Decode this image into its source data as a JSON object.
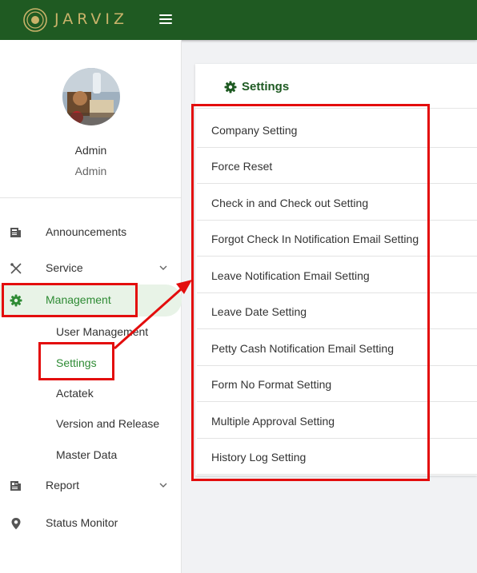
{
  "app": {
    "brand": "JARVIZ"
  },
  "user": {
    "name": "Admin",
    "role": "Admin"
  },
  "sidebar": {
    "items": [
      {
        "label": "Announcements"
      },
      {
        "label": "Service"
      },
      {
        "label": "Management"
      },
      {
        "label": "Report"
      },
      {
        "label": "Status Monitor"
      }
    ],
    "management_sub": [
      {
        "label": "User Management"
      },
      {
        "label": "Settings"
      },
      {
        "label": "Actatek"
      },
      {
        "label": "Version and Release"
      },
      {
        "label": "Master Data"
      }
    ]
  },
  "panel": {
    "title": "Settings",
    "items": [
      {
        "label": "Company Setting"
      },
      {
        "label": "Force Reset"
      },
      {
        "label": "Check in and Check out Setting"
      },
      {
        "label": "Forgot Check In Notification Email Setting"
      },
      {
        "label": "Leave Notification Email Setting"
      },
      {
        "label": "Leave Date Setting"
      },
      {
        "label": "Petty Cash Notification Email Setting"
      },
      {
        "label": "Form No Format Setting"
      },
      {
        "label": "Multiple Approval Setting"
      },
      {
        "label": "History Log Setting"
      }
    ]
  },
  "colors": {
    "topbar": "#1f5a22",
    "accent": "#2e8b34",
    "highlight": "#e30d0d",
    "brand_text": "#c9b36a"
  },
  "icons": {
    "logo": "target-circle-logo",
    "menu": "hamburger-icon",
    "announcements": "newspaper-icon",
    "service": "tools-icon",
    "management": "gear-icon",
    "report": "report-icon",
    "status_monitor": "map-pin-icon",
    "settings_title": "gear-icon"
  }
}
